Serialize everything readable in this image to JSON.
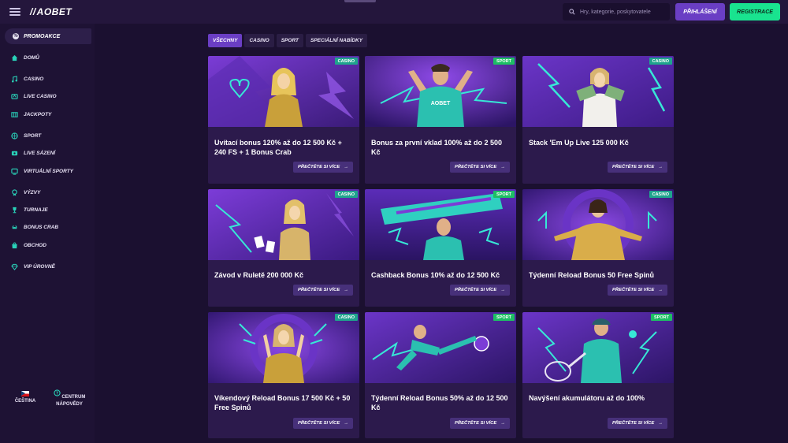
{
  "header": {
    "logo_text": "AOBET",
    "search_placeholder": "Hry, kategorie, poskytovatele",
    "login_label": "PŘIHLÁŠENÍ",
    "register_label": "REGISTRACE",
    "colors": {
      "login": "#6a3ec4",
      "register": "#19e38f"
    }
  },
  "sidebar": {
    "promo_label": "PROMOAKCE",
    "items": [
      {
        "label": "DOMŮ",
        "icon": "home-icon"
      },
      {
        "label": "CASINO",
        "icon": "music-note-icon"
      },
      {
        "label": "LIVE CASINO",
        "icon": "live-casino-icon"
      },
      {
        "label": "JACKPOTY",
        "icon": "jackpot-icon"
      },
      {
        "label": "SPORT",
        "icon": "sport-icon"
      },
      {
        "label": "LIVE SÁZENÍ",
        "icon": "live-bet-icon"
      },
      {
        "label": "VIRTUÁLNÍ SPORTY",
        "icon": "virtual-sport-icon"
      },
      {
        "label": "VÝZVY",
        "icon": "challenge-icon"
      },
      {
        "label": "TURNAJE",
        "icon": "trophy-icon"
      },
      {
        "label": "BONUS CRAB",
        "icon": "crab-icon"
      },
      {
        "label": "OBCHOD",
        "icon": "shop-icon"
      },
      {
        "label": "VIP ÚROVNĚ",
        "icon": "diamond-icon"
      }
    ],
    "language_label": "ČEŠTINA",
    "help_label": "CENTRUM NÁPOVĚDY"
  },
  "filters": {
    "tabs": [
      "VŠECHNY",
      "CASINO",
      "SPORT",
      "SPECIÁLNÍ NABÍDKY"
    ],
    "active": "VŠECHNY"
  },
  "cards": [
    {
      "badge": "CASINO",
      "title": "Uvítací bonus 120% až do 12 500 Kč + 240 FS + 1 Bonus Crab",
      "button": "PŘEČTĚTE SI VÍCE",
      "art": "woman-gold-dress-heart"
    },
    {
      "badge": "SPORT",
      "title": "Bonus za první vklad 100% až do 2 500 Kč",
      "button": "PŘEČTĚTE SI VÍCE",
      "art": "football-player-celebrating"
    },
    {
      "badge": "CASINO",
      "title": "Stack 'Em Up Live 125 000 Kč",
      "button": "PŘEČTĚTE SI VÍCE",
      "art": "woman-with-banknotes"
    },
    {
      "badge": "CASINO",
      "title": "Závod v Ruletě 200 000 Kč",
      "button": "PŘEČTĚTE SI VÍCE",
      "art": "woman-throwing-cards"
    },
    {
      "badge": "SPORT",
      "title": "Cashback Bonus 10% až do 12 500 Kč",
      "button": "PŘEČTĚTE SI VÍCE",
      "art": "fan-with-scarf"
    },
    {
      "badge": "CASINO",
      "title": "Týdenní Reload Bonus 50 Free Spinů",
      "button": "PŘEČTĚTE SI VÍCE",
      "art": "woman-gold-jacket"
    },
    {
      "badge": "CASINO",
      "title": "Víkendový Reload Bonus 17 500 Kč + 50 Free Spinů",
      "button": "PŘEČTĚTE SI VÍCE",
      "art": "woman-victory-sign"
    },
    {
      "badge": "SPORT",
      "title": "Týdenní Reload Bonus 50% až do 12 500 Kč",
      "button": "PŘEČTĚTE SI VÍCE",
      "art": "football-bicycle-kick"
    },
    {
      "badge": "SPORT",
      "title": "Navýšení akumulátoru až do 100%",
      "button": "PŘEČTĚTE SI VÍCE",
      "art": "tennis-player"
    }
  ]
}
